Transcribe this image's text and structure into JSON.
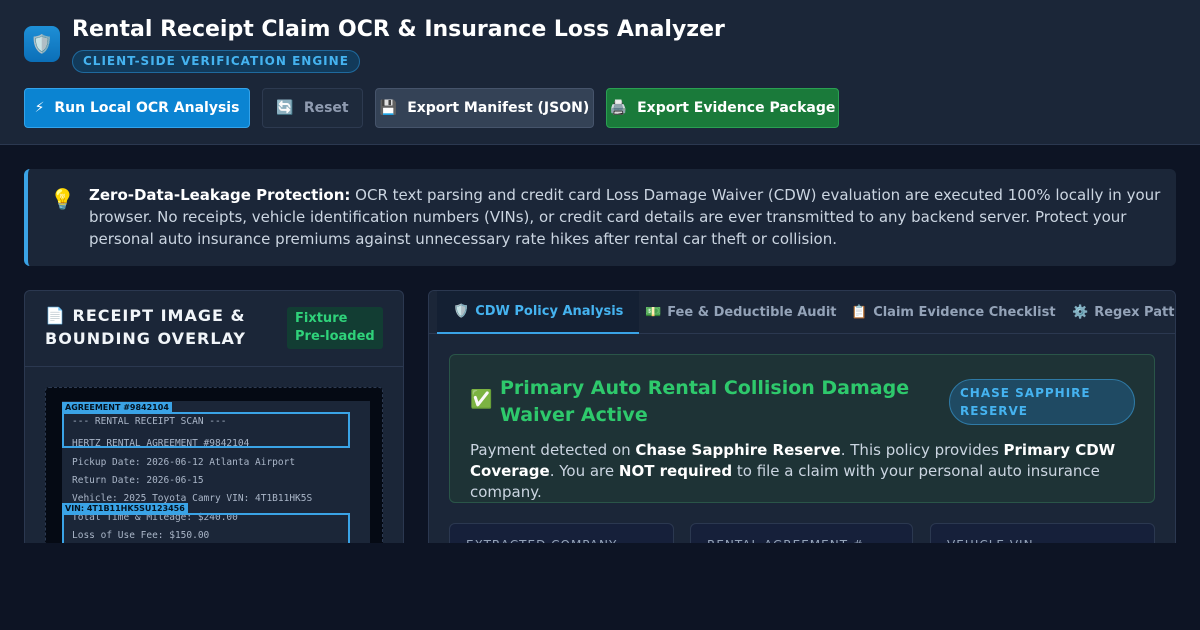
{
  "header": {
    "logo_icon": "shield-icon",
    "title": "Rental Receipt Claim OCR & Insurance Loss Analyzer",
    "badge": "CLIENT-SIDE VERIFICATION ENGINE"
  },
  "toolbar": {
    "run": {
      "icon": "⚡",
      "label": "Run Local OCR Analysis"
    },
    "reset": {
      "icon": "🔄",
      "label": "Reset"
    },
    "manifest": {
      "icon": "💾",
      "label": "Export Manifest (JSON)"
    },
    "evidence": {
      "icon": "🖨️",
      "label": "Export Evidence Package"
    }
  },
  "notice": {
    "icon": "💡",
    "bold": "Zero-Data-Leakage Protection:",
    "text": " OCR text parsing and credit card Loss Damage Waiver (CDW) evaluation are executed 100% locally in your browser. No receipts, vehicle identification numbers (VINs), or credit card details are ever transmitted to any backend server. Protect your personal auto insurance premiums against unnecessary rate hikes after rental car theft or collision."
  },
  "receipt_panel": {
    "icon": "📄",
    "title": "RECEIPT IMAGE & BOUNDING OVERLAY",
    "status": "Fixture Pre-loaded",
    "lines": [
      "--- RENTAL RECEIPT SCAN ---",
      "HERTZ RENTAL AGREEMENT #9842104",
      "Pickup Date: 2026-06-12 Atlanta Airport",
      "Return Date: 2026-06-15",
      "Vehicle: 2025 Toyota Camry VIN: 4T1B11HK5S",
      "Total Time & Mileage: $240.00",
      "Loss of Use Fee: $150.00"
    ],
    "boxes": [
      {
        "tag": "AGREEMENT #9842104"
      },
      {
        "tag": "VIN: 4T1B11HK5SU123456"
      }
    ]
  },
  "tabs": [
    {
      "icon": "🛡️",
      "label": "CDW Policy Analysis",
      "active": true
    },
    {
      "icon": "💵",
      "label": "Fee & Deductible Audit",
      "active": false
    },
    {
      "icon": "📋",
      "label": "Claim Evidence Checklist",
      "active": false
    },
    {
      "icon": "⚙️",
      "label": "Regex Patter",
      "active": false
    }
  ],
  "policy": {
    "icon": "✅",
    "title": "Primary Auto Rental Collision Damage Waiver Active",
    "card": "CHASE SAPPHIRE RESERVE",
    "t1": "Payment detected on ",
    "b1": "Chase Sapphire Reserve",
    "t2": ". This policy provides ",
    "b2": "Primary CDW Coverage",
    "t3": ". You are ",
    "b3": "NOT required",
    "t4": " to file a claim with your personal auto insurance company."
  },
  "fields": [
    {
      "label": "EXTRACTED COMPANY"
    },
    {
      "label": "RENTAL AGREEMENT #"
    },
    {
      "label": "VEHICLE VIN"
    }
  ],
  "colors": {
    "background": "#0d1424",
    "panel": "#1b2638",
    "accent": "#3aa3e6",
    "success": "#2ec96c",
    "export_green": "#1a7a3a"
  }
}
